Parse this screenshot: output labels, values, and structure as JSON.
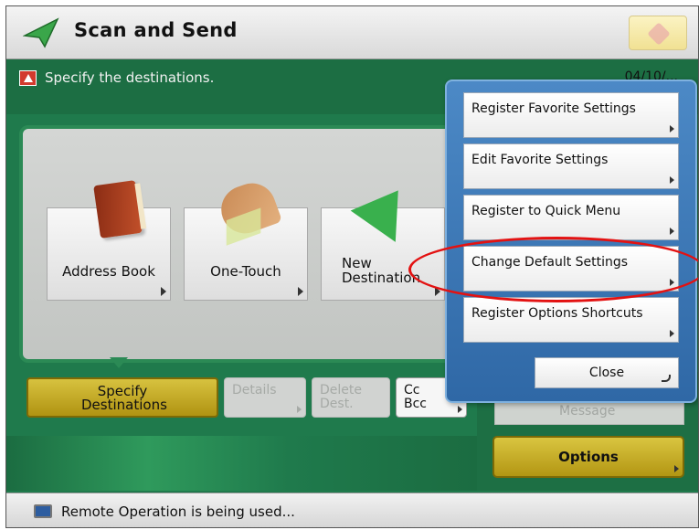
{
  "header": {
    "title": "Scan and Send",
    "app_icon": "paper-plane-icon"
  },
  "instruction": {
    "icon": "warning-icon",
    "text": "Specify the destinations.",
    "date": "04/10/..."
  },
  "destination_buttons": [
    {
      "label": "Address Book",
      "icon": "address-book-icon"
    },
    {
      "label": "One-Touch",
      "icon": "one-touch-hand-icon"
    },
    {
      "label": "New Destination",
      "icon": "paper-plane-icon"
    }
  ],
  "bottom_buttons": {
    "specify": "Specify Destinations",
    "details": "Details",
    "delete": "Delete Dest.",
    "cc_bcc": "Cc Bcc",
    "message": "Message",
    "options": "Options"
  },
  "popup_menu": {
    "items": [
      {
        "label": "Register Favorite Settings"
      },
      {
        "label": "Edit Favorite Settings"
      },
      {
        "label": "Register to Quick Menu"
      },
      {
        "label": "Change Default Settings"
      },
      {
        "label": "Register Options Shortcuts"
      }
    ],
    "close_label": "Close"
  },
  "status": {
    "icon": "remote-pc-icon",
    "text": "Remote Operation is being used..."
  },
  "colors": {
    "background_green": "#1f7a4c",
    "accent_yellow": "#c9b12a",
    "popup_blue": "#3b78b8",
    "highlight_red": "#e31212"
  }
}
